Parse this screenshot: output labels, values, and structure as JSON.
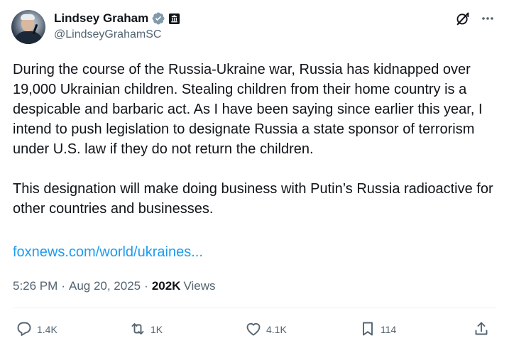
{
  "author": {
    "display_name": "Lindsey Graham",
    "handle": "@LindseyGrahamSC"
  },
  "tweet": {
    "paragraphs": [
      "During the course of the Russia-Ukraine war, Russia has kidnapped over 19,000 Ukrainian children. Stealing children from their home country is a despicable and barbaric act. As I have been saying since earlier this year, I intend to push legislation to designate Russia a state sponsor of terrorism under U.S. law if they do not return the children.",
      "This designation will make doing business with Putin’s Russia radioactive for other countries and businesses."
    ],
    "link_text": "foxnews.com/world/ukraines..."
  },
  "meta": {
    "time": "5:26 PM",
    "separator": "·",
    "date": "Aug 20, 2025",
    "views_count": "202K",
    "views_label": "Views"
  },
  "actions": {
    "replies": "1.4K",
    "reposts": "1K",
    "likes": "4.1K",
    "bookmarks": "114"
  },
  "icons": {
    "verified": "verified-badge-icon",
    "affiliation": "government-building-icon",
    "grok": "grok-icon",
    "more": "more-dots-icon",
    "reply": "reply-icon",
    "repost": "repost-icon",
    "like": "heart-icon",
    "bookmark": "bookmark-icon",
    "share": "share-icon"
  },
  "colors": {
    "text": "#0f1419",
    "secondary": "#536471",
    "link": "#1d9bf0",
    "verified_badge": "#829aab"
  }
}
